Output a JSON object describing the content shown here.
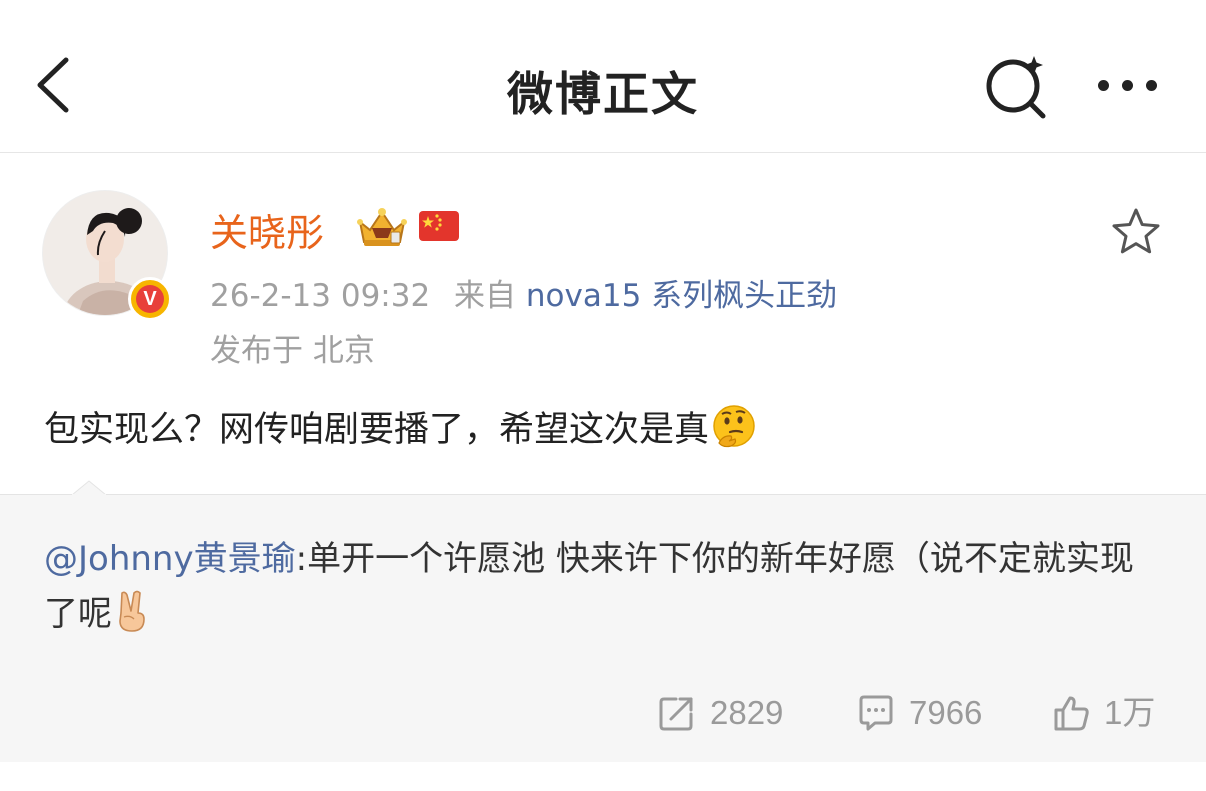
{
  "nav": {
    "title": "微博正文"
  },
  "post": {
    "author": "关晓彤",
    "time": "26-2-13 09:32",
    "source_prefix": "来自",
    "source": "nova15 系列枫头正劲",
    "location": "发布于 北京",
    "text": "包实现么？网传咱剧要播了，希望这次是真"
  },
  "repost": {
    "mention": "@Johnny黄景瑜",
    "text": ":单开一个许愿池 快来许下你的新年好愿（说不定就实现了呢"
  },
  "actions": {
    "reposts": "2829",
    "comments": "7966",
    "likes": "1万"
  },
  "icons": {
    "back": "chevron-left-icon",
    "search": "search-icon",
    "more": "more-icon",
    "favorite": "star-icon",
    "verified": "verified-badge-icon",
    "crown": "crown-icon",
    "flag": "china-flag-icon",
    "thinking": "thinking-face-icon",
    "victory": "victory-hand-icon",
    "repost": "repost-icon",
    "comment": "comment-icon",
    "like": "thumbs-up-icon"
  },
  "colors": {
    "username": "#e8641b",
    "link": "#4e6aa0",
    "meta": "#a0a0a0",
    "repost_bg": "#f6f6f6"
  }
}
